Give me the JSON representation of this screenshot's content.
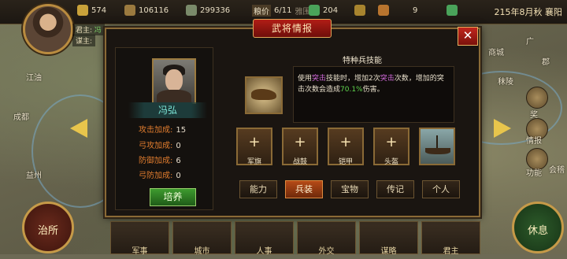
{
  "resources": {
    "r1": "574",
    "r2": "106116",
    "r3": "299336",
    "r4": "204",
    "r5": "9"
  },
  "top": {
    "label_a": "粮价",
    "value_a": "6/11",
    "label_b": "雅围",
    "date": "215年8月秋 襄阳"
  },
  "lord_info": {
    "lord": "君主:",
    "lord_name": "冯",
    "advisor": "谋主:"
  },
  "map_names": {
    "a": "江油",
    "b": "成都",
    "c": "益州",
    "d": "商城",
    "e": "秣陵",
    "f": "广",
    "g": "郡"
  },
  "side_buttons": {
    "b1": "奖",
    "b2": "情报",
    "b3": "功能",
    "b4": "会稽"
  },
  "dialog": {
    "title": "武将情报",
    "close": "✕"
  },
  "general": {
    "name": "冯弘",
    "stats": [
      {
        "label": "攻击加成:",
        "value": "15"
      },
      {
        "label": "弓攻加成:",
        "value": "0"
      },
      {
        "label": "防御加成:",
        "value": "6"
      },
      {
        "label": "弓防加成:",
        "value": "0"
      }
    ],
    "train": "培养"
  },
  "skill": {
    "title": "特种兵技能",
    "desc_1": "使用",
    "desc_2": "突击",
    "desc_3": "技能时，增加2次",
    "desc_4": "突击",
    "desc_5": "次数，增加的突击次数会造成",
    "desc_6": "70.1%",
    "desc_7": "伤害。"
  },
  "equipment": [
    {
      "label": "军旗"
    },
    {
      "label": "战鼓"
    },
    {
      "label": "铠甲"
    },
    {
      "label": "头盔"
    }
  ],
  "tabs": [
    "能力",
    "兵装",
    "宝物",
    "传记",
    "个人"
  ],
  "active_tab": "兵装",
  "bottom": {
    "left_circle": "治所",
    "right_circle": "休息",
    "menu": [
      "军事",
      "城市",
      "人事",
      "外交",
      "谋略",
      "君主"
    ]
  },
  "colors": {
    "accent": "#b01d16",
    "gold": "#e8c54c",
    "active_tab": "#b54a17"
  }
}
